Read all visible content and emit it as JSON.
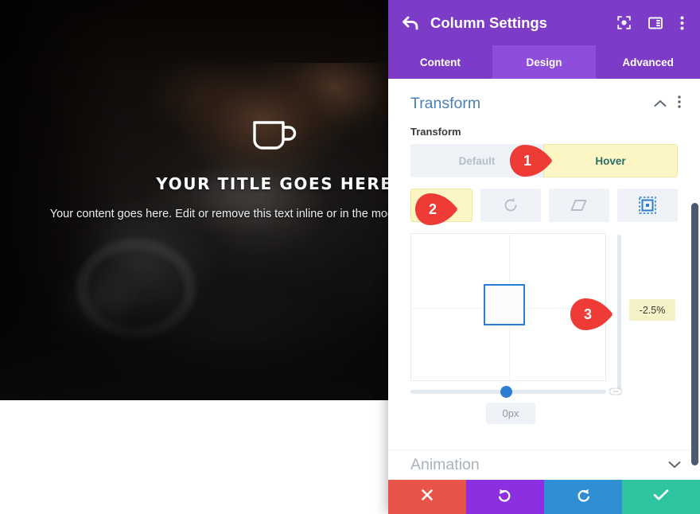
{
  "preview": {
    "icon": "coffee-cup-icon",
    "title": "YOUR TITLE GOES HERE",
    "body": "Your content goes here. Edit or remove this text inline or in the module Content settings."
  },
  "panel": {
    "header": {
      "back_icon": "back-arrow-icon",
      "title": "Column Settings",
      "icons": [
        {
          "name": "focus-target-icon"
        },
        {
          "name": "layout-columns-icon"
        },
        {
          "name": "more-vertical-icon"
        }
      ]
    },
    "tabs": [
      {
        "label": "Content",
        "active": false
      },
      {
        "label": "Design",
        "active": true
      },
      {
        "label": "Advanced",
        "active": false
      }
    ],
    "section": {
      "title": "Transform",
      "collapse_icon": "chevron-up-icon",
      "options_icon": "more-vertical-icon",
      "field_label": "Transform",
      "states": [
        {
          "label": "Default",
          "active": false
        },
        {
          "label": "Hover",
          "active": true
        }
      ],
      "transform_types": [
        {
          "name": "move-icon",
          "active": true
        },
        {
          "name": "rotate-icon",
          "active": false
        },
        {
          "name": "skew-icon",
          "active": false
        },
        {
          "name": "origin-icon",
          "active": false
        }
      ],
      "percent_value": "-2.5%",
      "offset_value": "0px",
      "link_icon": "link-chain-icon"
    },
    "animation": {
      "title": "Animation",
      "expand_icon": "chevron-down-icon"
    },
    "footer": [
      {
        "name": "cancel-button",
        "icon": "close-x-icon",
        "color": "#e8544a"
      },
      {
        "name": "undo-button",
        "icon": "undo-arrow-icon",
        "color": "#8b2fe0"
      },
      {
        "name": "redo-button",
        "icon": "redo-arrow-icon",
        "color": "#2e8fd4"
      },
      {
        "name": "save-button",
        "icon": "checkmark-icon",
        "color": "#2ec4a0"
      }
    ]
  },
  "markers": [
    {
      "label": "1"
    },
    {
      "label": "2"
    },
    {
      "label": "3"
    }
  ],
  "colors": {
    "panel_purple": "#7d3cc8",
    "tab_active_purple": "#8f4ddb",
    "section_blue": "#4a7fb5",
    "highlight_yellow": "#fbf6c4",
    "accent_blue": "#2d7dd2",
    "marker_red": "#ef3b36"
  }
}
